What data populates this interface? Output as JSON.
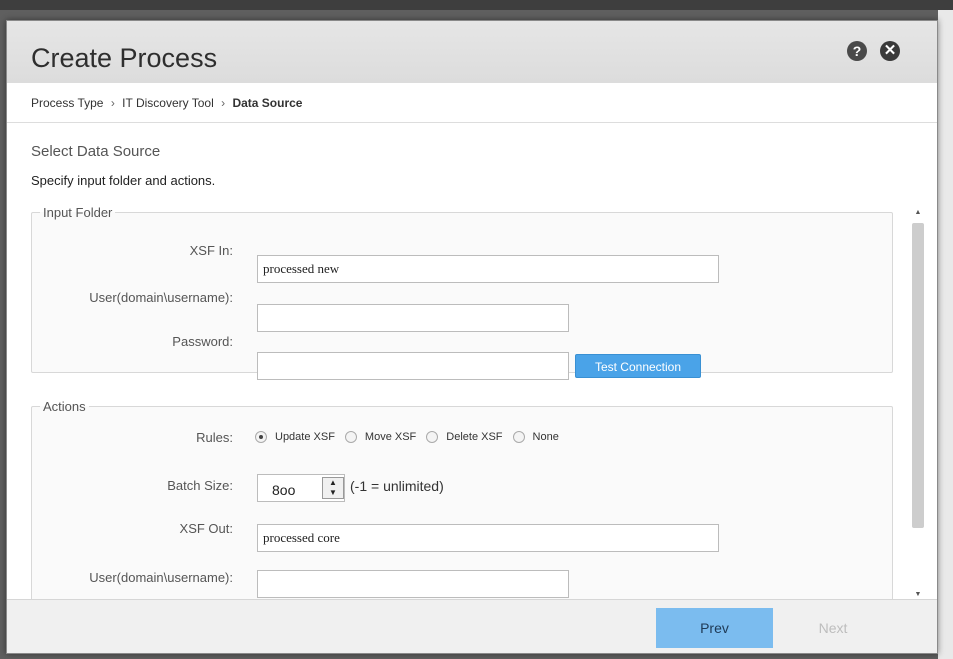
{
  "dialog": {
    "title": "Create Process",
    "help_glyph": "?",
    "close_glyph": "✕"
  },
  "breadcrumb": {
    "items": [
      "Process Type",
      "IT Discovery Tool",
      "Data Source"
    ],
    "separator": "›"
  },
  "section": {
    "title": "Select Data Source",
    "description": "Specify input folder and actions."
  },
  "input_folder": {
    "legend": "Input Folder",
    "xsf_in_label": "XSF In:",
    "xsf_in_value": "processed new",
    "user_label": "User(domain\\username):",
    "user_value": "",
    "password_label": "Password:",
    "password_value": "",
    "test_connection_label": "Test Connection"
  },
  "actions": {
    "legend": "Actions",
    "rules_label": "Rules:",
    "rules_options": [
      "Update XSF",
      "Move XSF",
      "Delete XSF",
      "None"
    ],
    "rules_selected": "Update XSF",
    "batch_size_label": "Batch Size:",
    "batch_size_value": "8oo",
    "batch_size_hint": "(-1 = unlimited)",
    "xsf_out_label": "XSF Out:",
    "xsf_out_value": "processed core",
    "user_label": "User(domain\\username):",
    "user_value": ""
  },
  "footer": {
    "prev_label": "Prev",
    "next_label": "Next"
  },
  "colors": {
    "accent": "#7bbcef",
    "test_button": "#4aa3e8",
    "header_bg": "#e2e2e2"
  },
  "icons": {
    "help": "help-icon",
    "close": "close-icon",
    "spinner": "spinner-arrows-icon",
    "scroll_up": "scroll-up-icon",
    "scroll_down": "scroll-down-icon"
  }
}
